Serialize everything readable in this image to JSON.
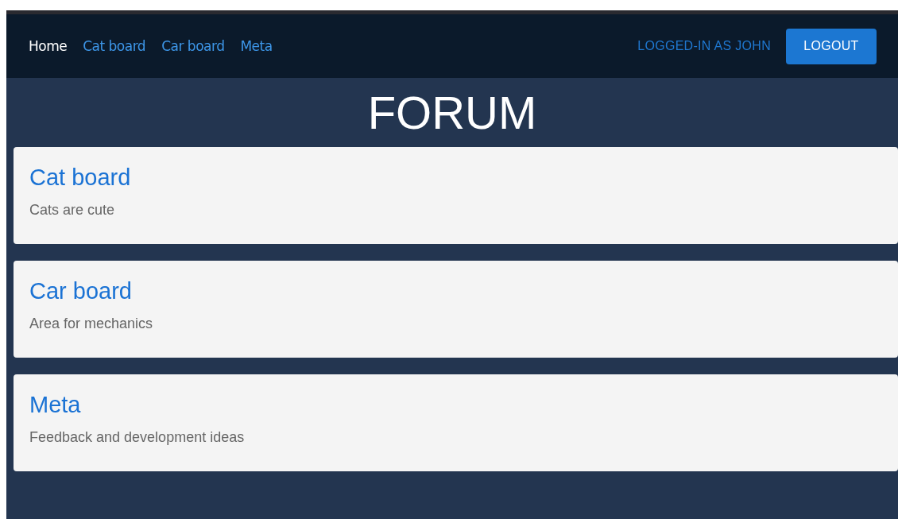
{
  "nav": {
    "links": [
      {
        "label": "Home",
        "selected": true
      },
      {
        "label": "Cat board",
        "selected": false
      },
      {
        "label": "Car board",
        "selected": false
      },
      {
        "label": "Meta",
        "selected": false
      }
    ],
    "user_label": "LOGGED-IN AS JOHN",
    "logout_button": "LOGOUT"
  },
  "title": "FORUM",
  "boards": [
    {
      "name": "Cat board",
      "description": "Cats are cute"
    },
    {
      "name": "Car board",
      "description": "Area for mechanics"
    },
    {
      "name": "Meta",
      "description": "Feedback and development ideas"
    }
  ]
}
